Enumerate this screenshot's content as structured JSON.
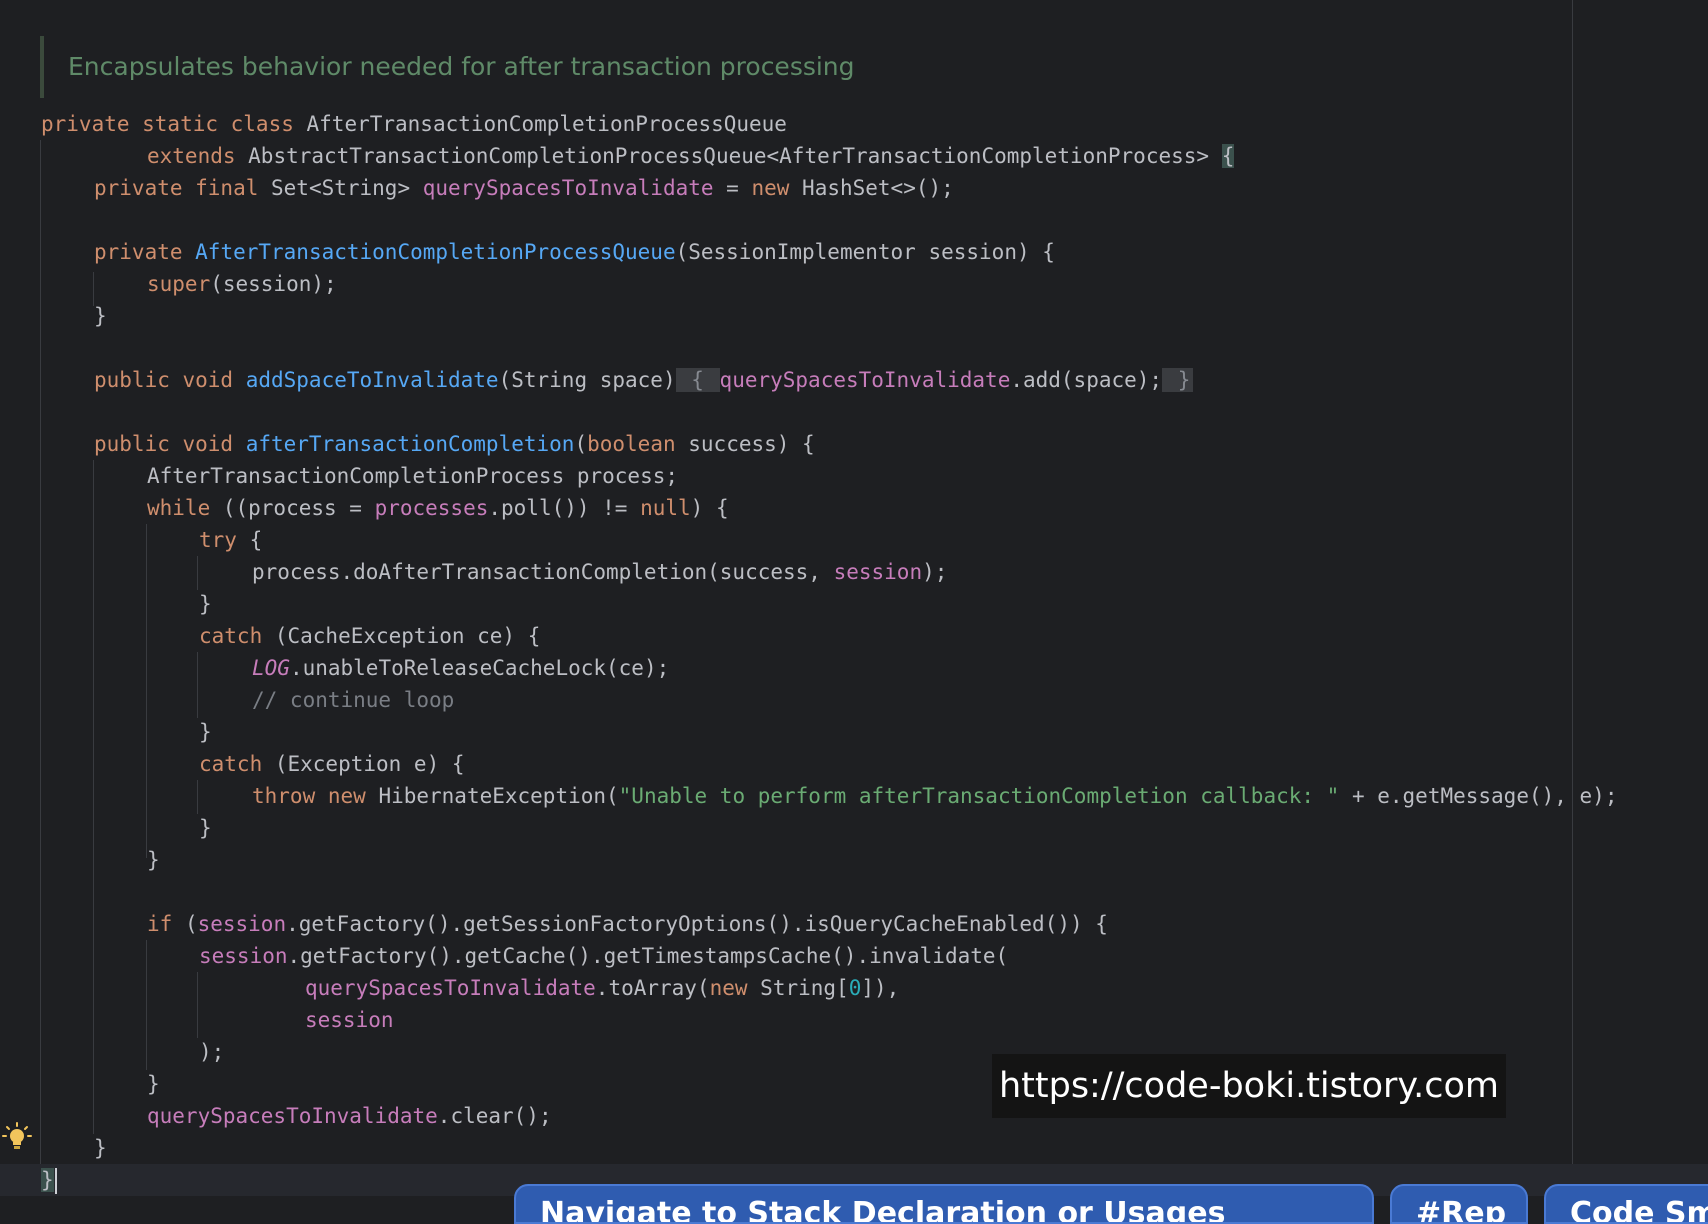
{
  "doc_comment": "Encapsulates behavior needed for after transaction processing",
  "code": {
    "l1": {
      "a": "private static class ",
      "b": "AfterTransactionCompletionProcessQueue"
    },
    "l2": {
      "a": "extends ",
      "b": "AbstractTransactionCompletionProcessQueue<AfterTransactionCompletionProcess> ",
      "c": "{"
    },
    "l3": {
      "a": "private final ",
      "b": "Set<String> ",
      "c": "querySpacesToInvalidate",
      "d": " = ",
      "e": "new ",
      "f": "HashSet<>();"
    },
    "l4": {
      "a": "private ",
      "b": "AfterTransactionCompletionProcessQueue",
      "c": "(SessionImplementor session) {"
    },
    "l5": {
      "a": "super",
      "b": "(session);"
    },
    "l6": {
      "a": "}"
    },
    "l7": {
      "a": "public void ",
      "b": "addSpaceToInvalidate",
      "c": "(String space)",
      "d": " { ",
      "e": "querySpacesToInvalidate",
      "f": ".add(space);",
      "g": " }"
    },
    "l8": {
      "a": "public void ",
      "b": "afterTransactionCompletion",
      "c": "(",
      "d": "boolean ",
      "e": "success) {"
    },
    "l9": {
      "a": "AfterTransactionCompletionProcess process;"
    },
    "l10": {
      "a": "while ",
      "b": "((process = ",
      "c": "processes",
      "d": ".poll()) != ",
      "e": "null",
      "f": ") {"
    },
    "l11": {
      "a": "try ",
      "b": "{"
    },
    "l12": {
      "a": "process.doAfterTransactionCompletion(success, ",
      "b": "session",
      "c": ");"
    },
    "l13": {
      "a": "}"
    },
    "l14": {
      "a": "catch ",
      "b": "(CacheException ce) {"
    },
    "l15": {
      "a": "LOG",
      "b": ".unableToReleaseCacheLock(ce);"
    },
    "l16": {
      "a": "// continue loop"
    },
    "l17": {
      "a": "}"
    },
    "l18": {
      "a": "catch ",
      "b": "(Exception e) {"
    },
    "l19": {
      "a": "throw new ",
      "b": "HibernateException(",
      "c": "\"Unable to perform afterTransactionCompletion callback: \"",
      "d": " + e.getMessage(), e);"
    },
    "l20": {
      "a": "}"
    },
    "l21": {
      "a": "}"
    },
    "l22": {
      "a": "if ",
      "b": "(",
      "c": "session",
      "d": ".getFactory().getSessionFactoryOptions().isQueryCacheEnabled()) {"
    },
    "l23": {
      "a": "session",
      "b": ".getFactory().getCache().getTimestampsCache().invalidate("
    },
    "l24": {
      "a": "querySpacesToInvalidate",
      "b": ".toArray(",
      "c": "new ",
      "d": "String[",
      "e": "0",
      "f": "]),"
    },
    "l25": {
      "a": "session"
    },
    "l26": {
      "a": ");"
    },
    "l27": {
      "a": "}"
    },
    "l28": {
      "a": "querySpacesToInvalidate",
      "b": ".clear();"
    },
    "l29": {
      "a": "}"
    },
    "l30": {
      "a": "}"
    }
  },
  "watermark": "https://code-boki.tistory.com",
  "bottom_tabs": [
    "Navigate to Stack Declaration or Usages",
    "#Rep",
    "Code Smell"
  ],
  "icons": {
    "intention": "lightbulb-icon"
  },
  "colors": {
    "background": "#1e1f22",
    "keyword": "#cf8e6d",
    "field": "#c77dbb",
    "function": "#56a8f5",
    "string": "#6aab73",
    "number": "#2aacb8",
    "comment": "#7a7e85",
    "text": "#bcbec4"
  }
}
